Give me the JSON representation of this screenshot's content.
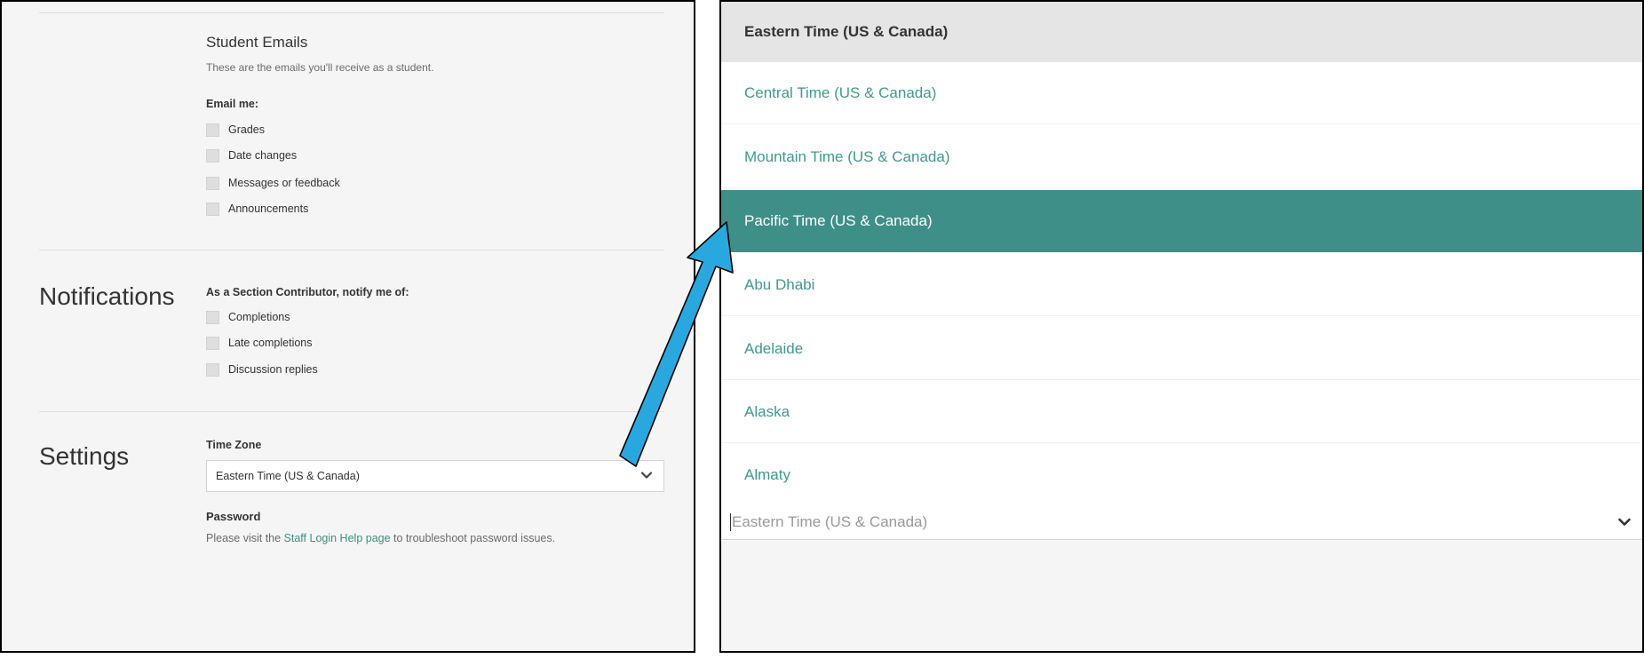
{
  "student_emails": {
    "title": "Student Emails",
    "description": "These are the emails you'll receive as a student.",
    "email_me_label": "Email me:",
    "options": [
      "Grades",
      "Date changes",
      "Messages or feedback",
      "Announcements"
    ]
  },
  "notifications": {
    "heading": "Notifications",
    "label": "As a Section Contributor, notify me of:",
    "options": [
      "Completions",
      "Late completions",
      "Discussion replies"
    ]
  },
  "settings": {
    "heading": "Settings",
    "time_zone_label": "Time Zone",
    "time_zone_value": "Eastern Time (US & Canada)",
    "password_label": "Password",
    "password_text_before": "Please visit the ",
    "password_link": "Staff Login Help page",
    "password_text_after": " to troubleshoot password issues."
  },
  "dropdown": {
    "header": "Eastern Time (US & Canada)",
    "items": [
      "Central Time (US & Canada)",
      "Mountain Time (US & Canada)",
      "Pacific Time (US & Canada)",
      "Abu Dhabi",
      "Adelaide",
      "Alaska",
      "Almaty"
    ],
    "selected_index": 2,
    "search_placeholder": "Eastern Time (US & Canada)"
  },
  "colors": {
    "accent": "#3e8f88",
    "link": "#3a8f87",
    "arrow": "#29a8e0"
  }
}
